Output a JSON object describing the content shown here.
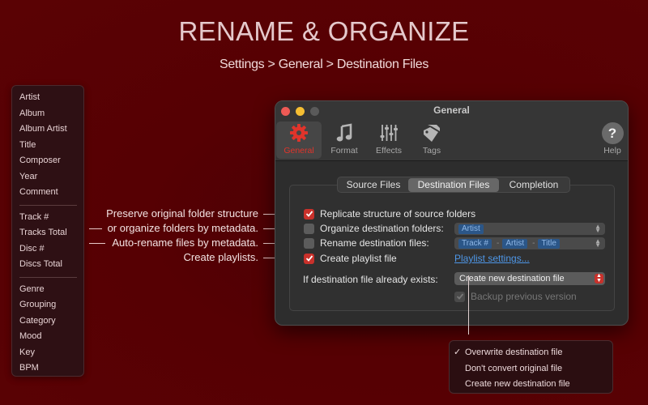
{
  "headline": "RENAME & ORGANIZE",
  "subhead": "Settings > General > Destination Files",
  "tag_menu": {
    "groups": [
      [
        "Artist",
        "Album",
        "Album Artist",
        "Title",
        "Composer",
        "Year",
        "Comment"
      ],
      [
        "Track #",
        "Tracks Total",
        "Disc #",
        "Discs Total"
      ],
      [
        "Genre",
        "Grouping",
        "Category",
        "Mood",
        "Key",
        "BPM"
      ]
    ]
  },
  "callouts": [
    "Preserve original folder structure",
    "or organize folders by metadata.",
    "Auto-rename files by metadata.",
    "Create playlists."
  ],
  "window": {
    "title": "General",
    "toolbar": [
      {
        "label": "General",
        "icon": "gear-icon",
        "selected": true
      },
      {
        "label": "Format",
        "icon": "music-note-icon"
      },
      {
        "label": "Effects",
        "icon": "sliders-icon"
      },
      {
        "label": "Tags",
        "icon": "tags-icon"
      }
    ],
    "help": {
      "label": "Help",
      "glyph": "?"
    },
    "tabs": [
      "Source Files",
      "Destination Files",
      "Completion"
    ],
    "selected_tab": "Destination Files",
    "options": [
      {
        "label": "Replicate structure of source folders",
        "checked": true
      },
      {
        "label": "Organize destination folders:",
        "checked": false
      },
      {
        "label": "Rename destination files:",
        "checked": false
      },
      {
        "label": "Create playlist file",
        "checked": true
      }
    ],
    "folder_tokens": [
      "Artist"
    ],
    "filename_tokens": [
      "Track #",
      "Artist",
      "Title"
    ],
    "token_separator": "-",
    "playlist_link": "Playlist settings...",
    "exists_label": "If destination file already exists:",
    "exists_value": "Create new destination file",
    "backup": {
      "label": "Backup previous version",
      "checked": true,
      "enabled": false
    }
  },
  "exists_options": {
    "items": [
      "Overwrite destination file",
      "Don't convert original file",
      "Create new destination file"
    ],
    "checked_index": 0,
    "check_glyph": "✓"
  },
  "colors": {
    "background": "#560003",
    "accent_red": "#c9312b",
    "link_blue": "#4e97e8"
  }
}
